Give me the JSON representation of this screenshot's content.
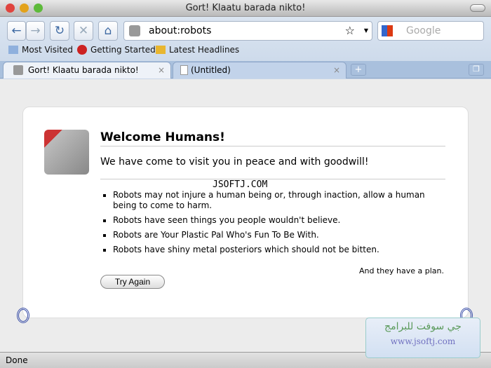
{
  "window": {
    "title": "Gort! Klaatu barada nikto!"
  },
  "toolbar": {
    "back": "←",
    "forward": "→",
    "reload": "↻",
    "stop": "✕",
    "home": "⌂",
    "url": "about:robots",
    "search_placeholder": "Google"
  },
  "bookmarks": [
    {
      "label": "Most Visited"
    },
    {
      "label": "Getting Started"
    },
    {
      "label": "Latest Headlines"
    }
  ],
  "tabs": [
    {
      "label": "Gort! Klaatu barada nikto!",
      "active": true
    },
    {
      "label": "(Untitled)",
      "active": false
    }
  ],
  "page": {
    "title": "Welcome Humans!",
    "subtitle": "We have come to visit you in peace and with goodwill!",
    "brand": "JSOFTJ.COM",
    "items": [
      "Robots may not injure a human being or, through inaction, allow a human being to come to harm.",
      "Robots have seen things you people wouldn't believe.",
      "Robots are Your Plastic Pal Who's Fun To Be With.",
      "Robots have shiny metal posteriors which should not be bitten."
    ],
    "plan": "And they have a plan.",
    "button": "Try Again"
  },
  "status": "Done",
  "watermark": {
    "arabic": "جي سوفت للبرامج",
    "url": "www.jsoftj.com"
  }
}
